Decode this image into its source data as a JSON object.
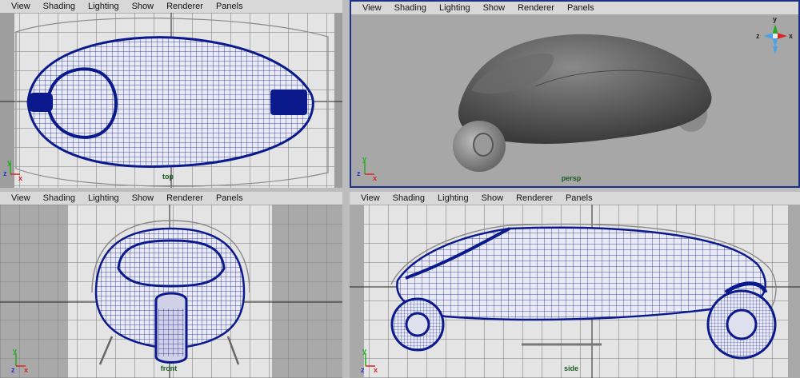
{
  "menu": [
    "View",
    "Shading",
    "Lighting",
    "Show",
    "Renderer",
    "Panels"
  ],
  "panels": {
    "top": {
      "camera": "top"
    },
    "persp": {
      "camera": "persp"
    },
    "front": {
      "camera": "front"
    },
    "side": {
      "camera": "side"
    }
  },
  "axes": {
    "x": "x",
    "y": "y",
    "z": "z"
  },
  "colors": {
    "wire": "#0a1a8c",
    "grid": "#5c5c5c",
    "axis_x": "#d22",
    "axis_y": "#2a2",
    "axis_z": "#23c",
    "active_border": "#1e2f8a"
  }
}
